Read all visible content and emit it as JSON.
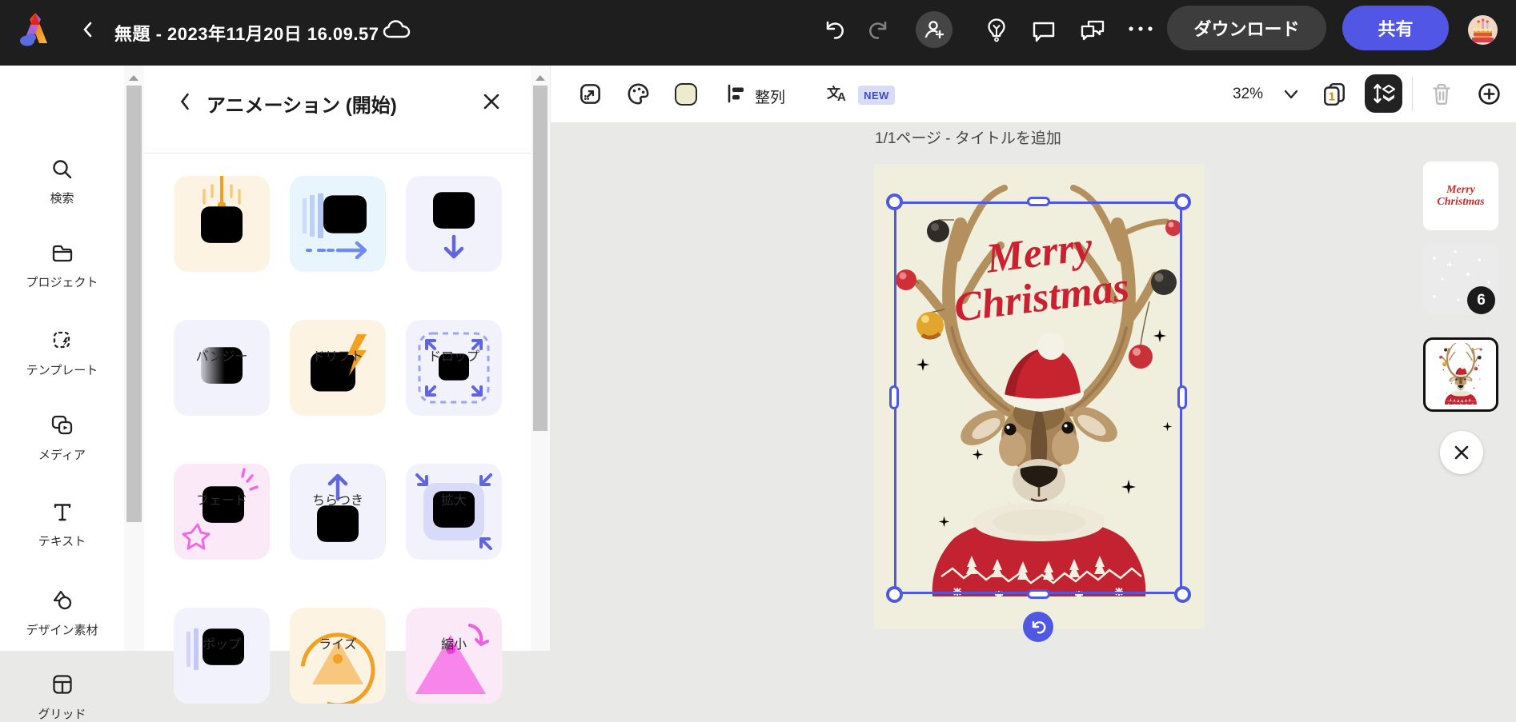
{
  "topbar": {
    "title": "無題 - 2023年11月20日 16.09.57",
    "download_label": "ダウンロード",
    "share_label": "共有"
  },
  "sidebar": {
    "items": [
      {
        "label": "検索",
        "icon": "search-icon"
      },
      {
        "label": "プロジェクト",
        "icon": "projects-folder-icon"
      },
      {
        "label": "テンプレート",
        "icon": "templates-icon"
      },
      {
        "label": "メディア",
        "icon": "media-icon"
      },
      {
        "label": "テキスト",
        "icon": "text-icon"
      },
      {
        "label": "デザイン素材",
        "icon": "design-assets-icon"
      },
      {
        "label": "グリッド",
        "icon": "grid-icon"
      }
    ]
  },
  "panel": {
    "title": "アニメーション (開始)",
    "tiles": [
      {
        "label": "バンジー",
        "icon": "bungee-animation-icon"
      },
      {
        "label": "ドリフト",
        "icon": "drift-animation-icon"
      },
      {
        "label": "ドロップ",
        "icon": "drop-animation-icon"
      },
      {
        "label": "フェード",
        "icon": "fade-animation-icon"
      },
      {
        "label": "ちらつき",
        "icon": "flicker-animation-icon"
      },
      {
        "label": "拡大",
        "icon": "zoom-in-animation-icon"
      },
      {
        "label": "ポップ",
        "icon": "pop-animation-icon"
      },
      {
        "label": "ライズ",
        "icon": "rise-animation-icon"
      },
      {
        "label": "縮小",
        "icon": "zoom-out-animation-icon"
      }
    ]
  },
  "toolbar": {
    "align_label": "整列",
    "new_badge": "NEW",
    "zoom_level": "32%",
    "page_indicator": "1"
  },
  "canvas": {
    "page_label": "1/1ページ - タイトルを追加",
    "badge_count": "6",
    "card_text_line1": "Merry",
    "card_text_line2": "Christmas"
  },
  "colors": {
    "accent_blue": "#4f58e3",
    "share_button": "#5157e4",
    "card_bg": "#f0eedc",
    "topbar_bg": "#1e1e1e"
  }
}
